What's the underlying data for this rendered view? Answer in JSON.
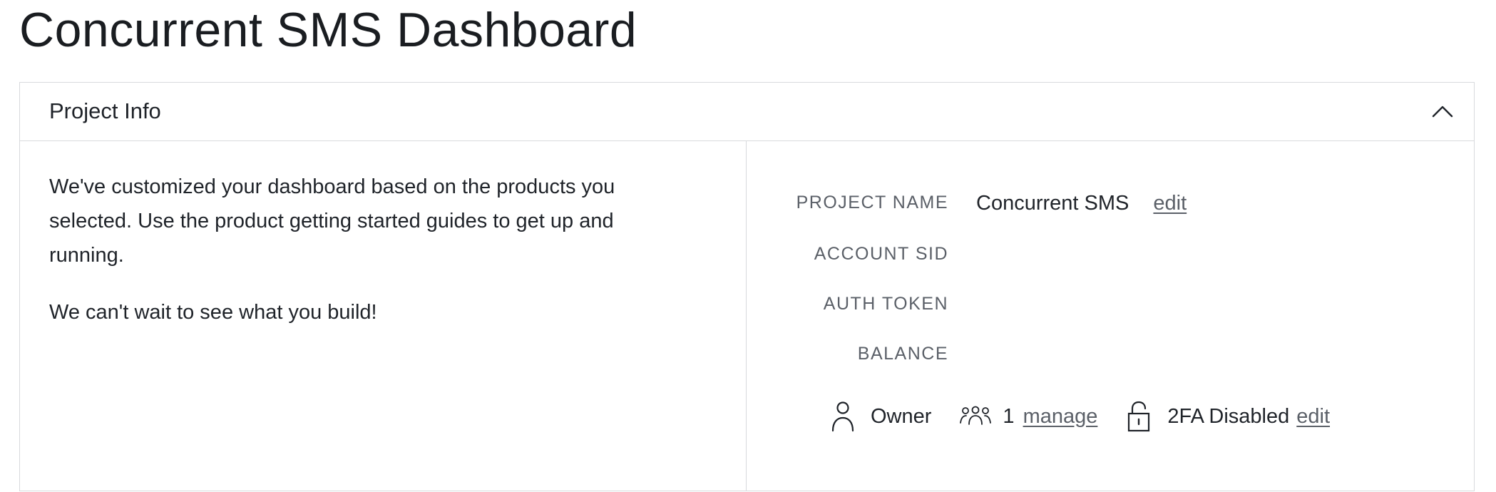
{
  "page": {
    "title": "Concurrent SMS Dashboard"
  },
  "project_info": {
    "header": "Project Info",
    "collapse_icon": "chevron-up-icon",
    "intro_text": "We've customized your dashboard based on the products you selected. Use the product getting started guides to get up and running.",
    "outro_text": "We can't wait to see what you build!",
    "fields": {
      "project_name": {
        "label": "PROJECT NAME",
        "value": "Concurrent SMS",
        "action": "edit"
      },
      "account_sid": {
        "label": "ACCOUNT SID",
        "value": ""
      },
      "auth_token": {
        "label": "AUTH TOKEN",
        "value": ""
      },
      "balance": {
        "label": "BALANCE",
        "value": ""
      }
    },
    "footer": {
      "role_icon": "user-icon",
      "role": "Owner",
      "members_icon": "group-icon",
      "member_count": "1",
      "members_action": "manage",
      "security_icon": "lock-icon",
      "twofa_status": "2FA Disabled",
      "twofa_action": "edit"
    }
  },
  "colors": {
    "border": "#d8dadd",
    "text": "#1f2329",
    "muted": "#5b6068",
    "background": "#ffffff"
  }
}
